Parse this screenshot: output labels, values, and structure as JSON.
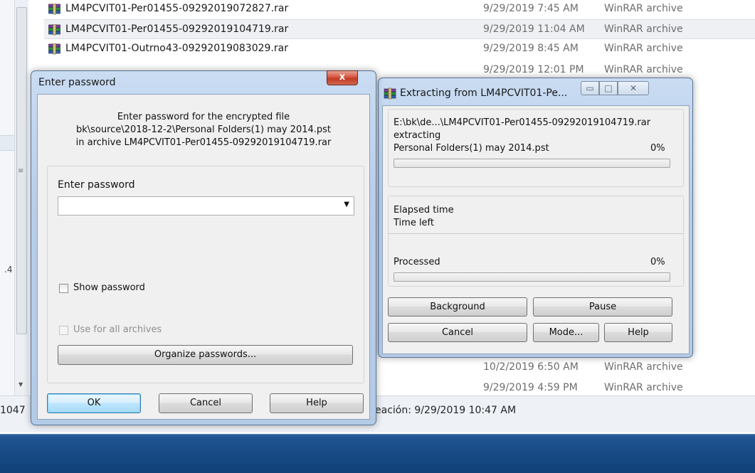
{
  "explorer": {
    "files": [
      {
        "name": "LM4PCVIT01-Per01455-09292019072827.rar",
        "date": "9/29/2019 7:45 AM",
        "type": "WinRAR archive"
      },
      {
        "name": "LM4PCVIT01-Per01455-09292019104719.rar",
        "date": "9/29/2019 11:04 AM",
        "type": "WinRAR archive"
      },
      {
        "name": "LM4PCVIT01-Outrno43-09292019083029.rar",
        "date": "9/29/2019 8:45 AM",
        "type": "WinRAR archive"
      },
      {
        "name": "",
        "date": "9/29/2019 12:01 PM",
        "type": "WinRAR archive"
      },
      {
        "name": "",
        "date": "10/2/2019 6:50 AM",
        "type": "WinRAR archive"
      },
      {
        "name": "",
        "date": "9/29/2019 4:59 PM",
        "type": "WinRAR archive"
      }
    ],
    "selected_index": 1,
    "details_left": "1047",
    "details_text": "eación: 9/29/2019 10:47 AM",
    "side_text": ".4",
    "archive_icon": "winrar-archive-icon",
    "taskbar_color": "#1a4f8b"
  },
  "password_dialog": {
    "title": "Enter password",
    "close_label": "x",
    "info_line1": "Enter password for the encrypted file",
    "info_line2": "bk\\source\\2018-12-2\\Personal Folders(1) may 2014.pst",
    "info_line3": "in archive LM4PCVIT01-Per01455-09292019104719.rar",
    "password_label": "Enter password",
    "password_value": "",
    "show_password_label": "Show password",
    "show_password_checked": false,
    "use_all_label": "Use for all archives",
    "use_all_enabled": false,
    "organize_label": "Organize passwords...",
    "ok_label": "OK",
    "cancel_label": "Cancel",
    "help_label": "Help"
  },
  "extract_window": {
    "title": "Extracting from LM4PCVIT01-Pe...",
    "minimize_glyph": "▭",
    "maximize_glyph": "□",
    "close_glyph": "✕",
    "path": "E:\\bk\\de...\\LM4PCVIT01-Per01455-09292019104719.rar",
    "status": "extracting",
    "current_file": "Personal Folders(1) may 2014.pst",
    "file_percent": "0%",
    "file_progress": 0,
    "elapsed_label": "Elapsed time",
    "timeleft_label": "Time left",
    "processed_label": "Processed",
    "processed_percent": "0%",
    "processed_progress": 0,
    "background_label": "Background",
    "pause_label": "Pause",
    "cancel_label": "Cancel",
    "mode_label": "Mode...",
    "help_label": "Help"
  }
}
